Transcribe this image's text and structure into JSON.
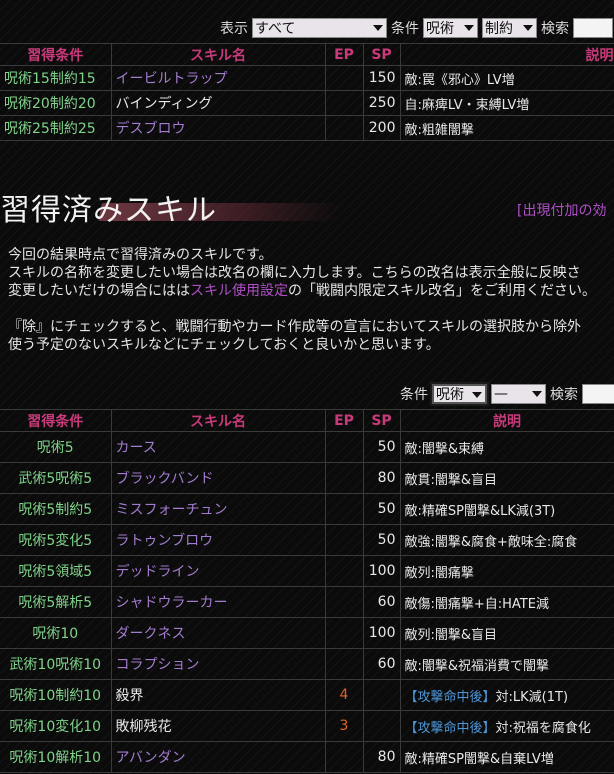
{
  "top_filter": {
    "display_label": "表示",
    "display_value": "すべて",
    "condition_label": "条件",
    "condition_value": "呪術",
    "constraint_value": "制約",
    "search_label": "検索"
  },
  "columns": {
    "condition": "習得条件",
    "name": "スキル名",
    "ep": "EP",
    "sp": "SP",
    "description": "説明"
  },
  "top_rows": [
    {
      "condition": "呪術15制約15",
      "name": "イービルトラップ",
      "ep": "",
      "sp": "150",
      "description": "敵:罠《邪心》LV増"
    },
    {
      "condition": "呪術20制約20",
      "name": "バインディング",
      "ep": "",
      "sp": "250",
      "description": "自:麻痺LV・束縛LV増"
    },
    {
      "condition": "呪術25制約25",
      "name": "デスブロウ",
      "ep": "",
      "sp": "200",
      "description": "敵:粗雑闇撃"
    }
  ],
  "section": {
    "title": "習得済みスキル",
    "appearance_link": "[出現付加の効"
  },
  "intro": {
    "line1": "今回の結果時点で習得済みのスキルです。",
    "line2": "スキルの名称を変更したい場合は改名の欄に入力します。こちらの改名は表示全般に反映さ",
    "line3_pre": "変更したいだけの場合にはは",
    "line3_link": "スキル使用設定",
    "line3_post": "の「戦闘内限定スキル改名」をご利用ください。",
    "line4": "『除』にチェックすると、戦闘行動やカード作成等の宣言においてスキルの選択肢から除外",
    "line5": "使う予定のないスキルなどにチェックしておくと良いかと思います。"
  },
  "bottom_filter": {
    "condition_label": "条件",
    "condition_value": "呪術",
    "constraint_value": "—",
    "search_label": "検索"
  },
  "learned_rows": [
    {
      "condition": "呪術5",
      "name": "カース",
      "ep": "",
      "sp": "50",
      "tag": "",
      "description": "敵:闇撃&束縛"
    },
    {
      "condition": "武術5呪術5",
      "name": "ブラックバンド",
      "ep": "",
      "sp": "80",
      "tag": "",
      "description": "敵貫:闇撃&盲目"
    },
    {
      "condition": "呪術5制約5",
      "name": "ミスフォーチュン",
      "ep": "",
      "sp": "50",
      "tag": "",
      "description": "敵:精確SP闇撃&LK減(3T)"
    },
    {
      "condition": "呪術5変化5",
      "name": "ラトゥンブロウ",
      "ep": "",
      "sp": "50",
      "tag": "",
      "description": "敵強:闇撃&腐食+敵味全:腐食"
    },
    {
      "condition": "呪術5領域5",
      "name": "デッドライン",
      "ep": "",
      "sp": "100",
      "tag": "",
      "description": "敵列:闇痛撃"
    },
    {
      "condition": "呪術5解析5",
      "name": "シャドウラーカー",
      "ep": "",
      "sp": "60",
      "tag": "",
      "description": "敵傷:闇痛撃+自:HATE減"
    },
    {
      "condition": "呪術10",
      "name": "ダークネス",
      "ep": "",
      "sp": "100",
      "tag": "",
      "description": "敵列:闇撃&盲目"
    },
    {
      "condition": "武術10呪術10",
      "name": "コラプション",
      "ep": "",
      "sp": "60",
      "tag": "",
      "description": "敵:闇撃&祝福消費で闇撃"
    },
    {
      "condition": "呪術10制約10",
      "name": "殺界",
      "ep": "4",
      "sp": "",
      "tag": "【攻撃命中後】",
      "description": "対:LK減(1T)"
    },
    {
      "condition": "呪術10変化10",
      "name": "敗柳残花",
      "ep": "3",
      "sp": "",
      "tag": "【攻撃命中後】",
      "description": "対:祝福を腐食化"
    },
    {
      "condition": "呪術10解析10",
      "name": "アバンダン",
      "ep": "",
      "sp": "80",
      "tag": "",
      "description": "敵:精確SP闇撃&自棄LV増"
    }
  ],
  "colors": {
    "header_pink": "#c93a7a",
    "condition_green": "#7fd38a",
    "skill_purple": "#a27ccf",
    "ep_orange": "#e0642a",
    "tag_blue": "#4d96d8"
  }
}
